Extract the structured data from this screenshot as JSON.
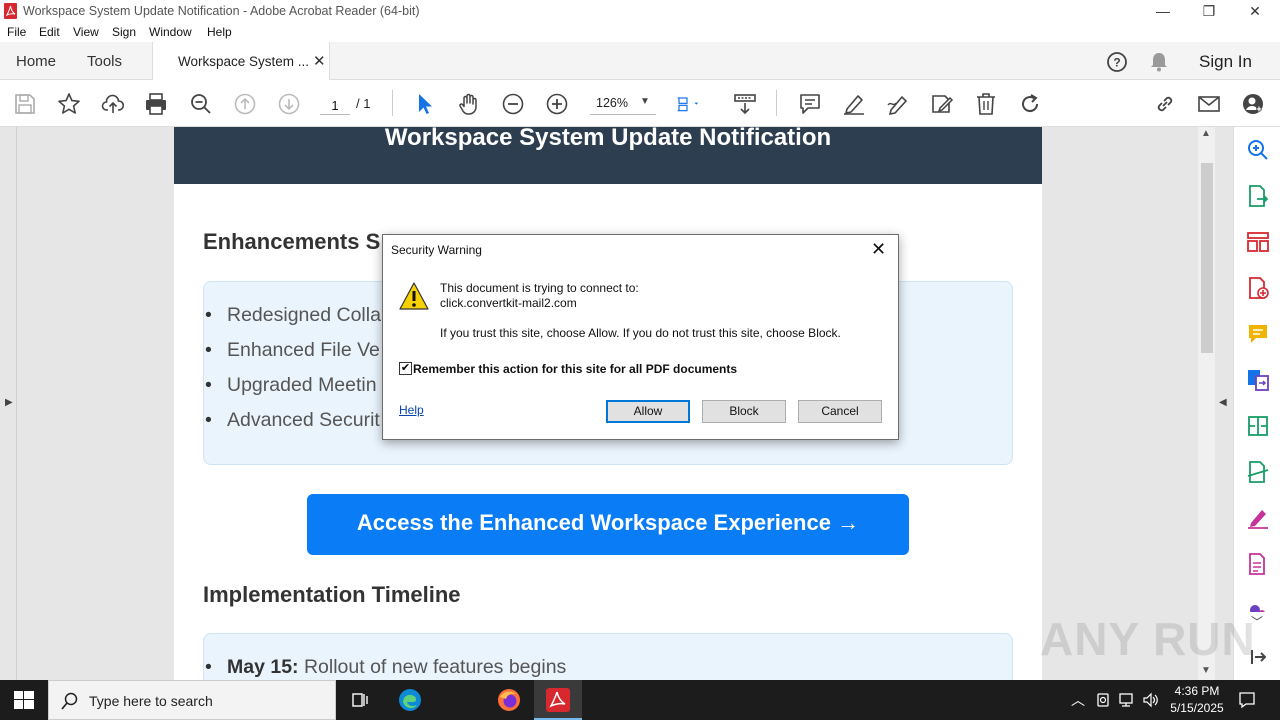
{
  "window": {
    "title": "Workspace System Update Notification - Adobe Acrobat Reader (64-bit)",
    "minimize": "—",
    "maximize": "❐",
    "close": "✕"
  },
  "menu": [
    "File",
    "Edit",
    "View",
    "Sign",
    "Window",
    "Help"
  ],
  "tabs": {
    "home": "Home",
    "tools": "Tools",
    "doc": "Workspace System ...",
    "doc_close": "✕",
    "sign_in": "Sign In"
  },
  "toolbar": {
    "page_current": "1",
    "page_total": "/ 1",
    "zoom": "126%"
  },
  "document": {
    "banner_title": "Workspace System Update Notification",
    "section1_heading": "Enhancements S",
    "bullets": [
      "Redesigned Colla",
      "Enhanced File Ve",
      "Upgraded Meetin",
      "Advanced Securit"
    ],
    "cta": "Access the Enhanced Workspace Experience →",
    "section2_heading": "Implementation Timeline",
    "timeline_date": "May 15:",
    "timeline_text": " Rollout of new features begins"
  },
  "dialog": {
    "title": "Security Warning",
    "line1": "This document is trying to connect to:",
    "url": "click.convertkit-mail2.com",
    "line2": "If you trust this site, choose Allow. If you do not trust this site, choose Block.",
    "checkbox_label": "Remember this action for this site for all PDF documents",
    "checkbox_checked": true,
    "help": "Help",
    "allow": "Allow",
    "block": "Block",
    "cancel": "Cancel"
  },
  "taskbar": {
    "search_placeholder": "Type here to search",
    "time": "4:36 PM",
    "date": "5/15/2025"
  },
  "watermark": "ANY RUN",
  "colors": {
    "banner": "#2c3e50",
    "cta": "#0a7cf5",
    "acrobat_red": "#d7282f",
    "icon_blue": "#1473e6"
  }
}
